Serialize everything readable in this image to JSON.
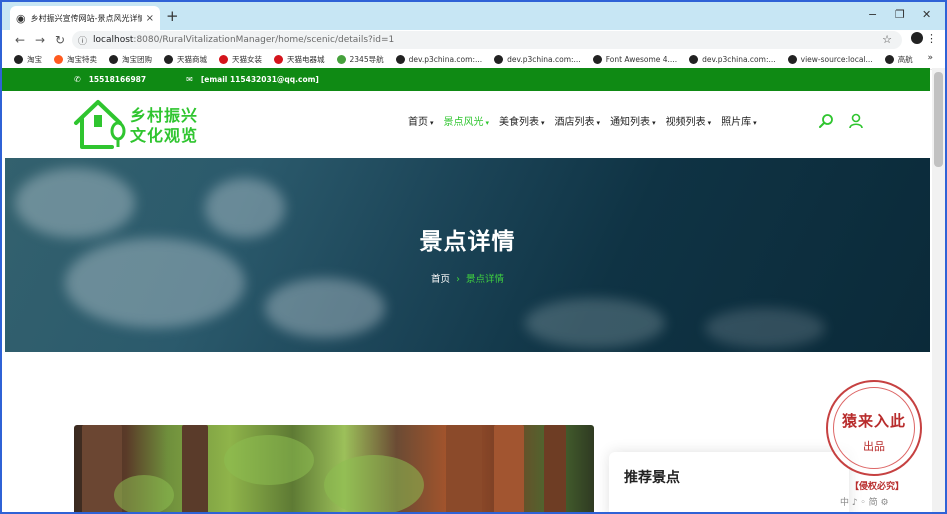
{
  "browser": {
    "tab_title": "乡村振兴宣传网站-景点风光详情",
    "tab_close": "×",
    "new_tab": "+",
    "window_controls": [
      "−",
      "❐",
      "✕"
    ],
    "nav_back": "←",
    "nav_forward": "→",
    "nav_reload": "↻",
    "url_host": "localhost",
    "url_rest": ":8080/RuralVitalizationManager/home/scenic/details?id=1",
    "bookmarks": [
      {
        "label": "淘宝",
        "color": "#222222"
      },
      {
        "label": "淘宝特卖",
        "color": "#ff5a1f"
      },
      {
        "label": "淘宝团购",
        "color": "#222222"
      },
      {
        "label": "天猫商城",
        "color": "#222222"
      },
      {
        "label": "天猫女装",
        "color": "#d4141c"
      },
      {
        "label": "天猫电器城",
        "color": "#d4141c"
      },
      {
        "label": "2345导航",
        "color": "#46a13c"
      },
      {
        "label": "dev.p3china.com:...",
        "color": "#222222"
      },
      {
        "label": "dev.p3china.com:...",
        "color": "#222222"
      },
      {
        "label": "Font Awesome 4....",
        "color": "#222222"
      },
      {
        "label": "dev.p3china.com:...",
        "color": "#222222"
      },
      {
        "label": "view-source:local...",
        "color": "#222222"
      },
      {
        "label": "高航",
        "color": "#222222"
      }
    ],
    "bookmarks_more": "»"
  },
  "topbar": {
    "phone_icon": "phone-icon",
    "phone": "15518166987",
    "email_icon": "envelope-icon",
    "email": "[email 115432031@qq.com]"
  },
  "header": {
    "logo_line1": "乡村振兴",
    "logo_line2": "文化观览",
    "menu": [
      {
        "label": "首页",
        "active": false
      },
      {
        "label": "景点风光",
        "active": true
      },
      {
        "label": "美食列表",
        "active": false
      },
      {
        "label": "酒店列表",
        "active": false
      },
      {
        "label": "通知列表",
        "active": false
      },
      {
        "label": "视频列表",
        "active": false
      },
      {
        "label": "照片库",
        "active": false
      }
    ],
    "search_icon": "search-icon",
    "user_icon": "user-icon",
    "accent": "#2fc52f"
  },
  "hero": {
    "title": "景点详情",
    "crumb_home": "首页",
    "crumb_sep": "›",
    "crumb_current": "景点详情"
  },
  "sidebar": {
    "card_title": "推荐景点"
  },
  "watermark": {
    "stamp_line1": "猿来入此",
    "stamp_line2": "出品",
    "notice": "【侵权必究】",
    "ime": "中 ♪ ◦ 简 ⚙"
  },
  "colors": {
    "topbar_bg": "#0f8a14",
    "accent_green": "#2fc52f",
    "browser_border": "#2f62d6"
  }
}
